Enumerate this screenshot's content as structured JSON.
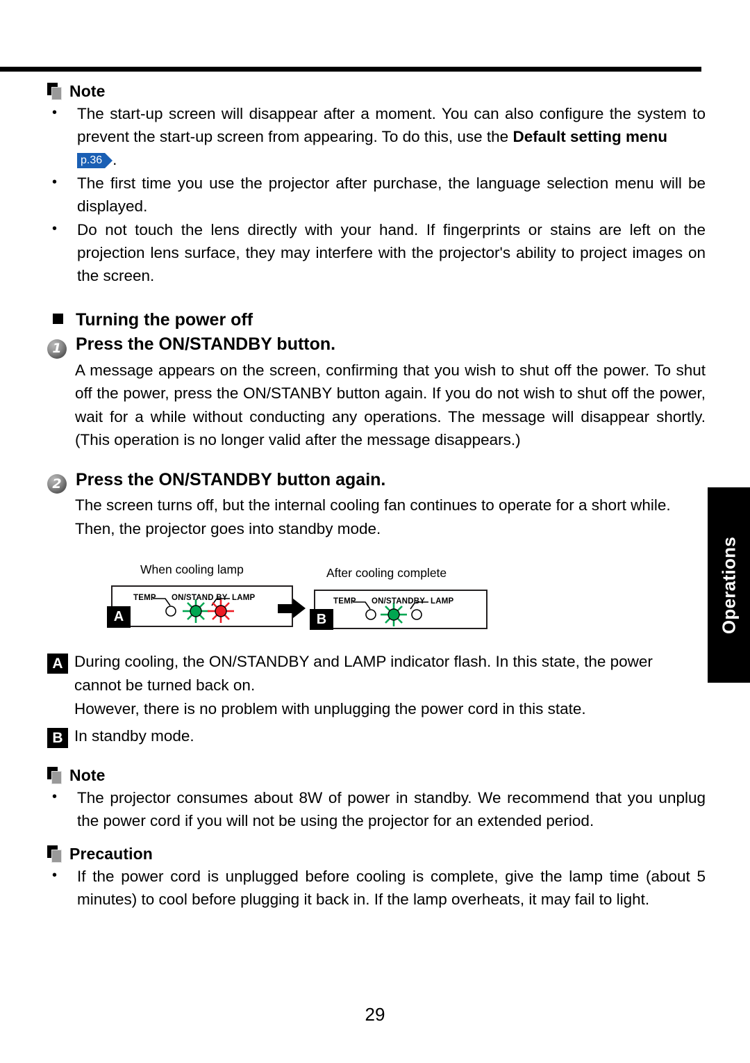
{
  "page": {
    "number": "29",
    "side_tab": "Operations"
  },
  "note_top": {
    "title": "Note",
    "bullets": [
      {
        "text_before": "The start-up screen will disappear after a moment. You can also configure the system to prevent the start-up screen from appearing. To do this, use the ",
        "bold": "Default setting menu",
        "page_ref": "p.36",
        "text_after": "."
      },
      {
        "text": "The first time you use the projector after purchase, the language selection menu will be displayed."
      },
      {
        "text": "Do not touch the lens directly with your hand. If fingerprints or stains are left on the projection lens surface, they may interfere with the projector's ability to project images on the screen."
      }
    ]
  },
  "section": {
    "heading": "Turning the power off",
    "steps": [
      {
        "number": "1",
        "title": "Press the ON/STANDBY button.",
        "body": "A message appears on the screen, confirming that you wish to shut off the power. To shut off the power, press the ON/STANBY button again. If you do not wish to shut off the power, wait for a while without conducting any operations. The message will disappear shortly. (This operation is no longer valid after the message disappears.)"
      },
      {
        "number": "2",
        "title": "Press the ON/STANDBY button again.",
        "body": "The screen turns off, but the internal cooling fan continues to operate for a short while. Then, the projector goes into standby mode."
      }
    ]
  },
  "figure": {
    "caption_left": "When cooling lamp",
    "caption_right": "After cooling complete",
    "panel_a": {
      "tag": "A",
      "labels": {
        "temp": "TEMP",
        "standby": "ON/STAND BY",
        "lamp": "LAMP"
      },
      "leds": [
        {
          "name": "temp",
          "state": "off",
          "color": "#ffffff"
        },
        {
          "name": "on-standby",
          "state": "flashing",
          "color": "#00a651"
        },
        {
          "name": "lamp",
          "state": "flashing",
          "color": "#ed1c24"
        }
      ]
    },
    "panel_b": {
      "tag": "B",
      "labels": {
        "temp": "TEMP",
        "standby": "ON/STANDBY",
        "lamp": "LAMP"
      },
      "leds": [
        {
          "name": "temp",
          "state": "off",
          "color": "#ffffff"
        },
        {
          "name": "on-standby",
          "state": "flashing",
          "color": "#00a651"
        },
        {
          "name": "lamp",
          "state": "off",
          "color": "#ffffff"
        }
      ]
    }
  },
  "callouts": [
    {
      "tag": "A",
      "text": "During cooling, the ON/STANDBY and LAMP indicator flash. In this state, the power",
      "line2": "cannot be turned back on.",
      "line3": "However, there is no problem with unplugging the power cord in this state."
    },
    {
      "tag": "B",
      "text": "In standby mode."
    }
  ],
  "note_bottom": {
    "title": "Note",
    "bullets": [
      {
        "text": "The projector consumes about 8W of power in standby. We recommend that you unplug the power cord if you will not be using the projector for an extended period."
      }
    ]
  },
  "precaution": {
    "title": "Precaution",
    "bullets": [
      {
        "text": "If the power cord is unplugged before cooling is complete, give the lamp time (about 5 minutes) to cool before plugging it back in. If the lamp overheats, it may fail to light."
      }
    ]
  }
}
